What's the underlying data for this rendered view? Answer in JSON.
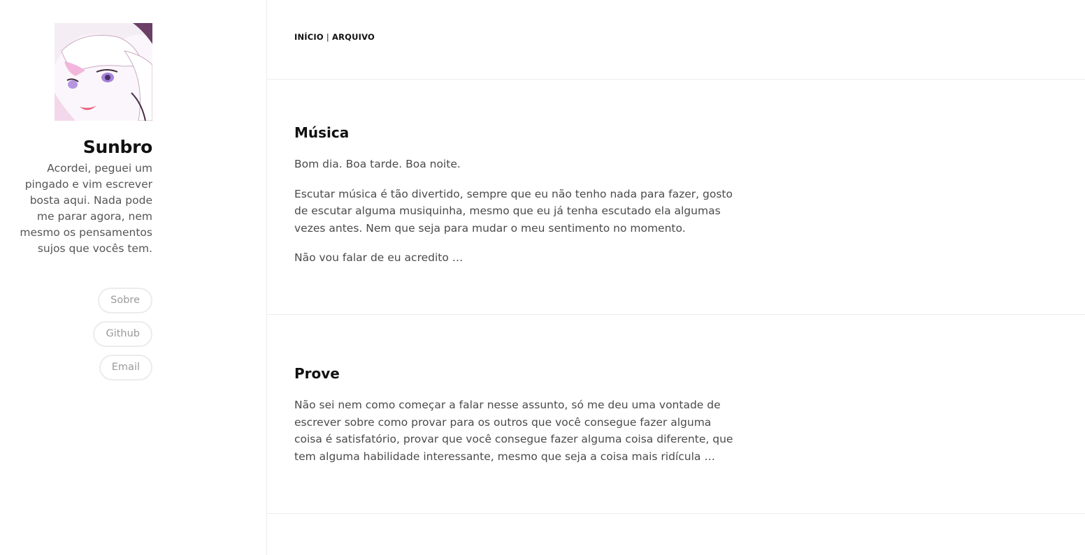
{
  "sidebar": {
    "site_title": "Sunbro",
    "tagline": "Acordei, peguei um pingado e vim escrever bosta aqui. Nada pode me parar agora, nem mesmo os pensamentos sujos que vocês tem.",
    "links": [
      {
        "label": "Sobre"
      },
      {
        "label": "Github"
      },
      {
        "label": "Email"
      }
    ]
  },
  "nav": {
    "home": "INÍCIO",
    "separator": "|",
    "archive": "ARQUIVO"
  },
  "posts": [
    {
      "title": "Música",
      "paragraphs": [
        "Bom dia. Boa tarde. Boa noite.",
        "Escutar música é tão divertido, sempre que eu não tenho nada para fazer, gosto de escutar alguma musiquinha, mesmo que eu já tenha escutado ela algumas vezes antes. Nem que seja para mudar o meu sentimento no momento.",
        "Não vou falar de eu acredito …"
      ]
    },
    {
      "title": "Prove",
      "paragraphs": [
        "Não sei nem como começar a falar nesse assunto, só me deu uma vontade de escrever sobre como provar para os outros que você consegue fazer alguma coisa é satisfatório, provar que você consegue fazer alguma coisa diferente, que tem alguma habilidade interessante, mesmo que seja a coisa mais ridícula …"
      ]
    }
  ],
  "colors": {
    "title": "#111111",
    "text": "#4a4a4a",
    "border": "#ececec",
    "pill_text": "#9a9a9a"
  }
}
